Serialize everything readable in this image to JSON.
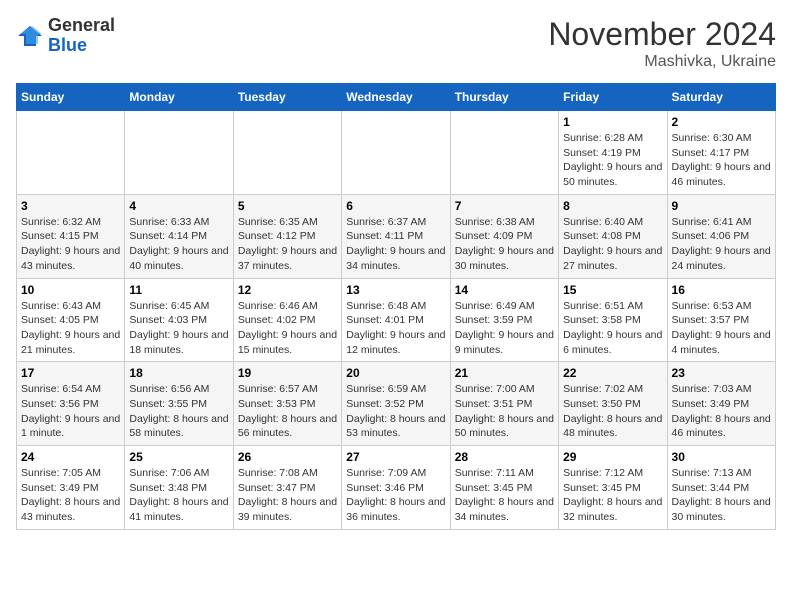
{
  "logo": {
    "general": "General",
    "blue": "Blue"
  },
  "header": {
    "month": "November 2024",
    "location": "Mashivka, Ukraine"
  },
  "weekdays": [
    "Sunday",
    "Monday",
    "Tuesday",
    "Wednesday",
    "Thursday",
    "Friday",
    "Saturday"
  ],
  "weeks": [
    [
      {
        "day": "",
        "info": ""
      },
      {
        "day": "",
        "info": ""
      },
      {
        "day": "",
        "info": ""
      },
      {
        "day": "",
        "info": ""
      },
      {
        "day": "",
        "info": ""
      },
      {
        "day": "1",
        "info": "Sunrise: 6:28 AM\nSunset: 4:19 PM\nDaylight: 9 hours and 50 minutes."
      },
      {
        "day": "2",
        "info": "Sunrise: 6:30 AM\nSunset: 4:17 PM\nDaylight: 9 hours and 46 minutes."
      }
    ],
    [
      {
        "day": "3",
        "info": "Sunrise: 6:32 AM\nSunset: 4:15 PM\nDaylight: 9 hours and 43 minutes."
      },
      {
        "day": "4",
        "info": "Sunrise: 6:33 AM\nSunset: 4:14 PM\nDaylight: 9 hours and 40 minutes."
      },
      {
        "day": "5",
        "info": "Sunrise: 6:35 AM\nSunset: 4:12 PM\nDaylight: 9 hours and 37 minutes."
      },
      {
        "day": "6",
        "info": "Sunrise: 6:37 AM\nSunset: 4:11 PM\nDaylight: 9 hours and 34 minutes."
      },
      {
        "day": "7",
        "info": "Sunrise: 6:38 AM\nSunset: 4:09 PM\nDaylight: 9 hours and 30 minutes."
      },
      {
        "day": "8",
        "info": "Sunrise: 6:40 AM\nSunset: 4:08 PM\nDaylight: 9 hours and 27 minutes."
      },
      {
        "day": "9",
        "info": "Sunrise: 6:41 AM\nSunset: 4:06 PM\nDaylight: 9 hours and 24 minutes."
      }
    ],
    [
      {
        "day": "10",
        "info": "Sunrise: 6:43 AM\nSunset: 4:05 PM\nDaylight: 9 hours and 21 minutes."
      },
      {
        "day": "11",
        "info": "Sunrise: 6:45 AM\nSunset: 4:03 PM\nDaylight: 9 hours and 18 minutes."
      },
      {
        "day": "12",
        "info": "Sunrise: 6:46 AM\nSunset: 4:02 PM\nDaylight: 9 hours and 15 minutes."
      },
      {
        "day": "13",
        "info": "Sunrise: 6:48 AM\nSunset: 4:01 PM\nDaylight: 9 hours and 12 minutes."
      },
      {
        "day": "14",
        "info": "Sunrise: 6:49 AM\nSunset: 3:59 PM\nDaylight: 9 hours and 9 minutes."
      },
      {
        "day": "15",
        "info": "Sunrise: 6:51 AM\nSunset: 3:58 PM\nDaylight: 9 hours and 6 minutes."
      },
      {
        "day": "16",
        "info": "Sunrise: 6:53 AM\nSunset: 3:57 PM\nDaylight: 9 hours and 4 minutes."
      }
    ],
    [
      {
        "day": "17",
        "info": "Sunrise: 6:54 AM\nSunset: 3:56 PM\nDaylight: 9 hours and 1 minute."
      },
      {
        "day": "18",
        "info": "Sunrise: 6:56 AM\nSunset: 3:55 PM\nDaylight: 8 hours and 58 minutes."
      },
      {
        "day": "19",
        "info": "Sunrise: 6:57 AM\nSunset: 3:53 PM\nDaylight: 8 hours and 56 minutes."
      },
      {
        "day": "20",
        "info": "Sunrise: 6:59 AM\nSunset: 3:52 PM\nDaylight: 8 hours and 53 minutes."
      },
      {
        "day": "21",
        "info": "Sunrise: 7:00 AM\nSunset: 3:51 PM\nDaylight: 8 hours and 50 minutes."
      },
      {
        "day": "22",
        "info": "Sunrise: 7:02 AM\nSunset: 3:50 PM\nDaylight: 8 hours and 48 minutes."
      },
      {
        "day": "23",
        "info": "Sunrise: 7:03 AM\nSunset: 3:49 PM\nDaylight: 8 hours and 46 minutes."
      }
    ],
    [
      {
        "day": "24",
        "info": "Sunrise: 7:05 AM\nSunset: 3:49 PM\nDaylight: 8 hours and 43 minutes."
      },
      {
        "day": "25",
        "info": "Sunrise: 7:06 AM\nSunset: 3:48 PM\nDaylight: 8 hours and 41 minutes."
      },
      {
        "day": "26",
        "info": "Sunrise: 7:08 AM\nSunset: 3:47 PM\nDaylight: 8 hours and 39 minutes."
      },
      {
        "day": "27",
        "info": "Sunrise: 7:09 AM\nSunset: 3:46 PM\nDaylight: 8 hours and 36 minutes."
      },
      {
        "day": "28",
        "info": "Sunrise: 7:11 AM\nSunset: 3:45 PM\nDaylight: 8 hours and 34 minutes."
      },
      {
        "day": "29",
        "info": "Sunrise: 7:12 AM\nSunset: 3:45 PM\nDaylight: 8 hours and 32 minutes."
      },
      {
        "day": "30",
        "info": "Sunrise: 7:13 AM\nSunset: 3:44 PM\nDaylight: 8 hours and 30 minutes."
      }
    ]
  ]
}
